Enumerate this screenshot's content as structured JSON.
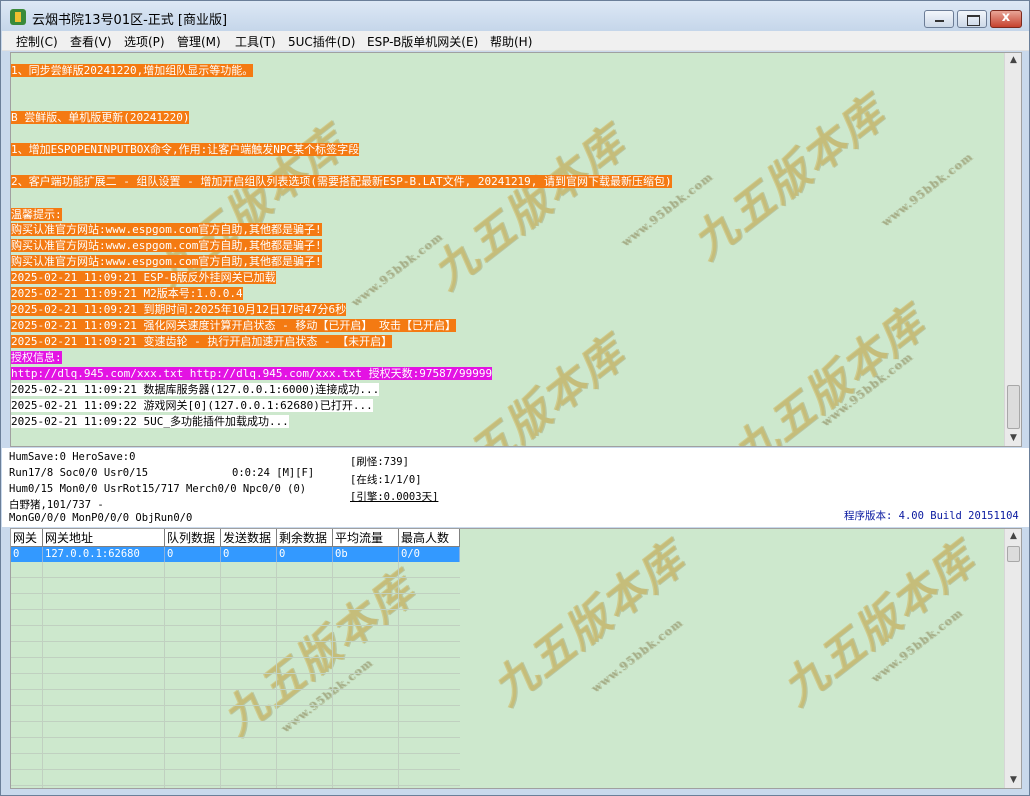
{
  "window": {
    "title": "云烟书院13号01区-正式 [商业版]",
    "close_glyph": "x"
  },
  "menu": [
    {
      "label": "控制(C)"
    },
    {
      "label": "查看(V)"
    },
    {
      "label": "选项(P)"
    },
    {
      "label": "管理(M)"
    },
    {
      "label": "工具(T)"
    },
    {
      "label": "5UC插件(D)"
    },
    {
      "label": "ESP-B版单机网关(E)"
    },
    {
      "label": "帮助(H)"
    }
  ],
  "log": {
    "lines": [
      {
        "text": "1、同步尝鲜版20241220,增加组队显示等功能。",
        "style": "orange"
      },
      {
        "text": "B 尝鲜版、单机版更新(20241220)",
        "style": "orange"
      },
      {
        "text": "1、增加ESPOPENINPUTBOX命令,作用:让客户端触发NPC某个标签字段",
        "style": "orange"
      },
      {
        "text": "2、客户端功能扩展二 - 组队设置 - 增加开启组队列表选项(需要搭配最新ESP-B.LAT文件, 20241219, 请到官网下载最新压缩包)",
        "style": "orange"
      },
      {
        "text": "温馨提示:",
        "style": "orange"
      },
      {
        "text": "购买认准官方网站:www.espgom.com官方自助,其他都是骗子!",
        "style": "orange"
      },
      {
        "text": "购买认准官方网站:www.espgom.com官方自助,其他都是骗子!",
        "style": "orange"
      },
      {
        "text": "购买认准官方网站:www.espgom.com官方自助,其他都是骗子!",
        "style": "orange"
      },
      {
        "text": "2025-02-21 11:09:21 ESP-B版反外挂网关已加载",
        "style": "orange"
      },
      {
        "text": "2025-02-21 11:09:21 M2版本号:1.0.0.4",
        "style": "orange"
      },
      {
        "text": "2025-02-21 11:09:21 到期时间:2025年10月12日17时47分6秒",
        "style": "orange"
      },
      {
        "text": "2025-02-21 11:09:21 强化网关速度计算开启状态 - 移动【已开启】 攻击【已开启】",
        "style": "orange"
      },
      {
        "text": "2025-02-21 11:09:21 变速齿轮 - 执行开启加速开启状态 - 【未开启】",
        "style": "orange"
      },
      {
        "text": "授权信息:",
        "style": "magenta"
      },
      {
        "text": "http://dlq.945.com/xxx.txt http://dlq.945.com/xxx.txt 授权天数:97587/99999",
        "style": "magenta"
      },
      {
        "text": "2025-02-21 11:09:21 数据库服务器(127.0.0.1:6000)连接成功...",
        "style": "white"
      },
      {
        "text": "2025-02-21 11:09:22 游戏网关[0](127.0.0.1:62680)已打开...",
        "style": "white"
      },
      {
        "text": "2025-02-21 11:09:22 5UC_多功能插件加载成功...",
        "style": "white"
      }
    ]
  },
  "status": {
    "humsave": "HumSave:0 HeroSave:0",
    "run": "Run17/8 Soc0/0 Usr0/15",
    "timer": "0:0:24 [M][F]",
    "hum": "Hum0/15 Mon0/0 UsrRot15/717 Merch0/0 Npc0/0 (0)",
    "boar": "白野猪,101/737 -",
    "mongo": "MonG0/0/0 MonP0/0/0 ObjRun0/0",
    "refresh": "[刷怪:739]",
    "online": "[在线:1/1/0]",
    "engine": "[引擎:0.0003天]",
    "version": "程序版本: 4.00 Build 20151104"
  },
  "grid": {
    "columns": [
      "网关",
      "网关地址",
      "队列数据",
      "发送数据",
      "剩余数据",
      "平均流量",
      "最高人数"
    ],
    "rows": [
      [
        "0",
        "127.0.0.1:62680",
        "0",
        "0",
        "0",
        "0b",
        "0/0"
      ]
    ]
  },
  "watermark": {
    "main": "九五版本库",
    "sub": "www.95bbk.com"
  },
  "colors": {
    "log_bg": "#cde8cd",
    "orange_highlight": "#f47a12",
    "magenta_highlight": "#e313e3",
    "selection": "#3399ff"
  }
}
